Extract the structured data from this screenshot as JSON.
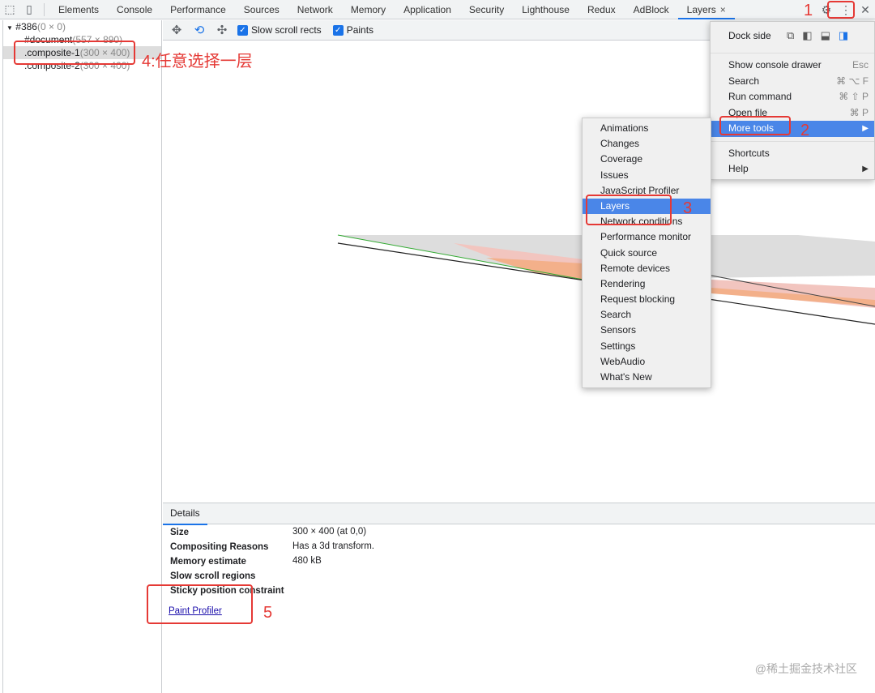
{
  "tabs": [
    {
      "label": "Elements"
    },
    {
      "label": "Console"
    },
    {
      "label": "Performance"
    },
    {
      "label": "Sources"
    },
    {
      "label": "Network"
    },
    {
      "label": "Memory"
    },
    {
      "label": "Application"
    },
    {
      "label": "Security"
    },
    {
      "label": "Lighthouse"
    },
    {
      "label": "Redux"
    },
    {
      "label": "AdBlock"
    },
    {
      "label": "Layers",
      "active": true
    }
  ],
  "tab_close": "×",
  "tree": {
    "root": "#386",
    "root_size": "(0 × 0)",
    "items": [
      {
        "name": "#document",
        "size": "(557 × 890)"
      },
      {
        "name": ".composite-1",
        "size": "(300 × 400)",
        "selected": true
      },
      {
        "name": ".composite-2",
        "size": "(300 × 400)"
      }
    ]
  },
  "toolbar": {
    "slow_scroll": "Slow scroll rects",
    "paints": "Paints",
    "slow_scroll_checked": true,
    "paints_checked": true
  },
  "details": {
    "tab": "Details",
    "rows": [
      {
        "label": "Size",
        "value": "300 × 400 (at 0,0)"
      },
      {
        "label": "Compositing Reasons",
        "value": "Has a 3d transform."
      },
      {
        "label": "Memory estimate",
        "value": "480 kB"
      },
      {
        "label": "Slow scroll regions",
        "value": ""
      },
      {
        "label": "Sticky position constraint",
        "value": ""
      }
    ],
    "link": "Paint Profiler"
  },
  "main_menu": {
    "dock_side": "Dock side",
    "items": [
      {
        "label": "Show console drawer",
        "shortcut": "Esc"
      },
      {
        "label": "Search",
        "shortcut": "⌘ ⌥ F"
      },
      {
        "label": "Run command",
        "shortcut": "⌘ ⇧ P"
      },
      {
        "label": "Open file",
        "shortcut": "⌘ P"
      },
      {
        "label": "More tools",
        "shortcut": "▶",
        "highlight": true
      }
    ],
    "items2": [
      {
        "label": "Shortcuts",
        "shortcut": ""
      },
      {
        "label": "Help",
        "shortcut": "▶"
      }
    ]
  },
  "more_tools": [
    "Animations",
    "Changes",
    "Coverage",
    "Issues",
    "JavaScript Profiler",
    "Layers",
    "Network conditions",
    "Performance monitor",
    "Quick source",
    "Remote devices",
    "Rendering",
    "Request blocking",
    "Search",
    "Sensors",
    "Settings",
    "WebAudio",
    "What's New"
  ],
  "annotations": {
    "a1": "1",
    "a2": "2",
    "a3": "3",
    "a4": "4:任意选择一层",
    "a5": "5"
  },
  "watermark": "@稀土掘金技术社区",
  "colors": {
    "accent": "#1a73e8",
    "highlight": "#4a86e8",
    "annotation": "#e53935"
  }
}
